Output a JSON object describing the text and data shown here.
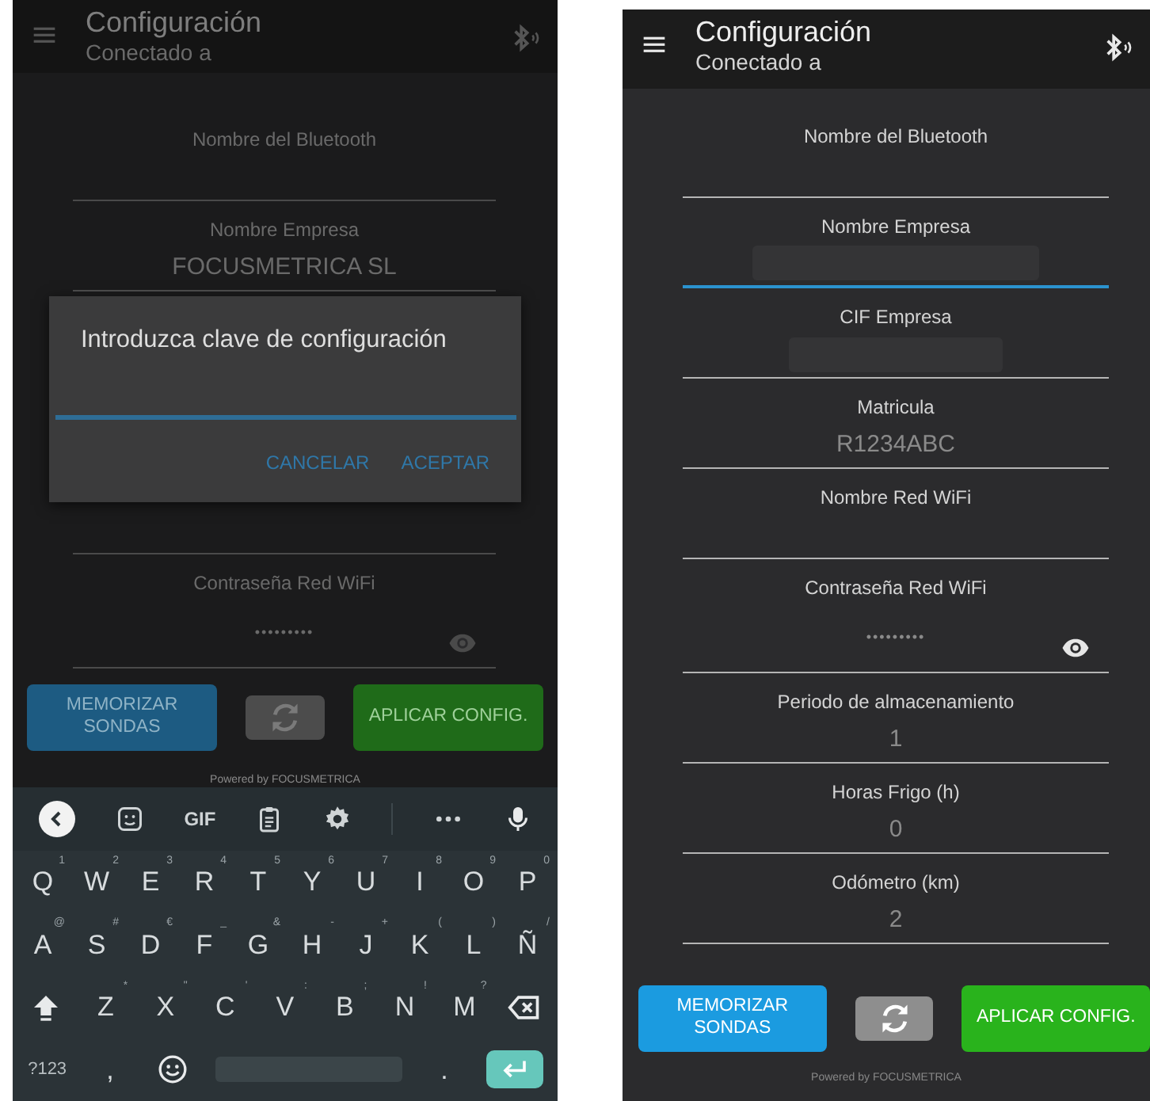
{
  "screens": [
    {
      "dimmed": true,
      "header": {
        "title": "Configuración",
        "subtitle": "Conectado a"
      },
      "fields": [
        {
          "label": "Nombre del Bluetooth",
          "kind": "text",
          "focused": false
        },
        {
          "label": "Nombre Empresa",
          "kind": "text",
          "value": "FOCUSMETRICA SL",
          "focused": false
        }
      ],
      "dialog": {
        "title": "Introduzca clave de configuración",
        "input_focused": true,
        "buttons": [
          "CANCELAR",
          "ACEPTAR"
        ]
      },
      "fields_below": [
        {
          "label": "Contraseña Red WiFi",
          "kind": "password",
          "value": "•••••••••",
          "focused": false
        }
      ],
      "buttons": [
        {
          "kind": "memorize",
          "label": "MEMORIZAR SONDAS"
        },
        {
          "kind": "refresh"
        },
        {
          "kind": "apply",
          "label": "APLICAR CONFIG."
        }
      ],
      "footer": "Powered by FOCUSMETRICA",
      "keyboard": {
        "toolbar": [
          {
            "kind": "back"
          },
          {
            "kind": "sticker"
          },
          {
            "kind": "text",
            "label": "GIF"
          },
          {
            "kind": "clipboard"
          },
          {
            "kind": "settings"
          },
          {
            "kind": "divider"
          },
          {
            "kind": "more"
          },
          {
            "kind": "mic"
          }
        ],
        "rows": [
          {
            "keys": [
              {
                "kind": "char",
                "key": "Q",
                "hint": "1"
              },
              {
                "kind": "char",
                "key": "W",
                "hint": "2"
              },
              {
                "kind": "char",
                "key": "E",
                "hint": "3"
              },
              {
                "kind": "char",
                "key": "R",
                "hint": "4"
              },
              {
                "kind": "char",
                "key": "T",
                "hint": "5"
              },
              {
                "kind": "char",
                "key": "Y",
                "hint": "6"
              },
              {
                "kind": "char",
                "key": "U",
                "hint": "7"
              },
              {
                "kind": "char",
                "key": "I",
                "hint": "8"
              },
              {
                "kind": "char",
                "key": "O",
                "hint": "9"
              },
              {
                "kind": "char",
                "key": "P",
                "hint": "0"
              }
            ]
          },
          {
            "keys": [
              {
                "kind": "char",
                "key": "A",
                "hint": "@"
              },
              {
                "kind": "char",
                "key": "S",
                "hint": "#"
              },
              {
                "kind": "char",
                "key": "D",
                "hint": "€"
              },
              {
                "kind": "char",
                "key": "F",
                "hint": "_"
              },
              {
                "kind": "char",
                "key": "G",
                "hint": "&"
              },
              {
                "kind": "char",
                "key": "H",
                "hint": "-"
              },
              {
                "kind": "char",
                "key": "J",
                "hint": "+"
              },
              {
                "kind": "char",
                "key": "K",
                "hint": "("
              },
              {
                "kind": "char",
                "key": "L",
                "hint": ")"
              },
              {
                "kind": "char",
                "key": "Ñ",
                "hint": "/"
              }
            ]
          },
          {
            "keys": [
              {
                "kind": "shift"
              },
              {
                "kind": "char",
                "key": "Z",
                "hint": "*"
              },
              {
                "kind": "char",
                "key": "X",
                "hint": "\""
              },
              {
                "kind": "char",
                "key": "C",
                "hint": "'"
              },
              {
                "kind": "char",
                "key": "V",
                "hint": ":"
              },
              {
                "kind": "char",
                "key": "B",
                "hint": ";"
              },
              {
                "kind": "char",
                "key": "N",
                "hint": "!"
              },
              {
                "kind": "char",
                "key": "M",
                "hint": "?"
              },
              {
                "kind": "backspace"
              }
            ]
          },
          {
            "keys": [
              {
                "kind": "symbols",
                "key": "?123"
              },
              {
                "kind": "char",
                "key": ","
              },
              {
                "kind": "emoji"
              },
              {
                "kind": "space"
              },
              {
                "kind": "char",
                "key": "."
              },
              {
                "kind": "enter"
              }
            ]
          }
        ]
      }
    },
    {
      "dimmed": false,
      "header": {
        "title": "Configuración",
        "subtitle": "Conectado a"
      },
      "fields": [
        {
          "label": "Nombre del Bluetooth",
          "kind": "text",
          "focused": false
        },
        {
          "label": "Nombre Empresa",
          "kind": "text",
          "redacted": true,
          "focused": true
        },
        {
          "label": "CIF Empresa",
          "kind": "text",
          "redacted": true,
          "focused": false
        },
        {
          "label": "Matricula",
          "kind": "text",
          "value": "R1234ABC",
          "focused": false
        },
        {
          "label": "Nombre Red WiFi",
          "kind": "text",
          "focused": false
        },
        {
          "label": "Contraseña Red WiFi",
          "kind": "password",
          "value": "•••••••••",
          "focused": false
        },
        {
          "label": "Periodo de almacenamiento",
          "kind": "text",
          "value": "1",
          "focused": false
        },
        {
          "label": "Horas Frigo (h)",
          "kind": "text",
          "value": "0",
          "focused": false
        },
        {
          "label": "Odómetro (km)",
          "kind": "text",
          "value": "2",
          "focused": false
        }
      ],
      "buttons": [
        {
          "kind": "memorize",
          "label": "MEMORIZAR SONDAS"
        },
        {
          "kind": "refresh"
        },
        {
          "kind": "apply",
          "label": "APLICAR CONFIG."
        }
      ],
      "footer": "Powered by FOCUSMETRICA"
    }
  ]
}
